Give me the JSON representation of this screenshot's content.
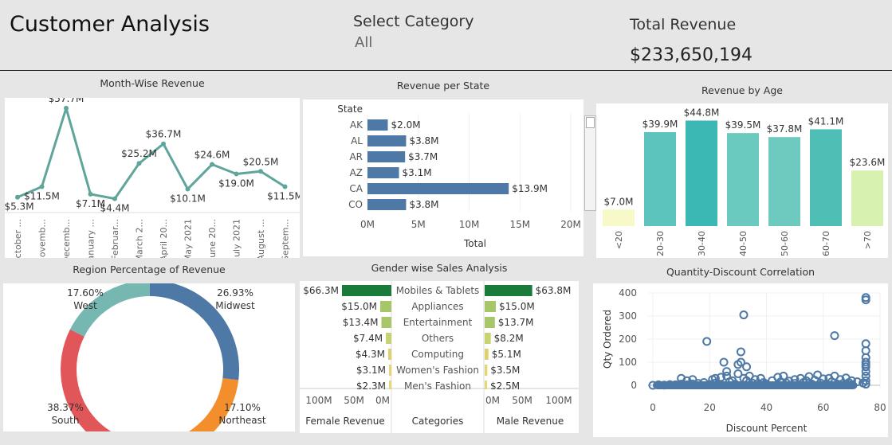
{
  "header": {
    "title": "Customer Analysis",
    "category_label": "Select Category",
    "category_value": "All",
    "revenue_label": "Total Revenue",
    "revenue_value": "$233,650,194"
  },
  "panels": {
    "month": "Month-Wise Revenue",
    "state": "Revenue per State",
    "age": "Revenue by Age",
    "region": "Region Percentage of Revenue",
    "gender": "Gender wise Sales Analysis",
    "qd": "Quantity-Discount Correlation"
  },
  "chart_data": [
    {
      "type": "line",
      "title": "Month-Wise Revenue",
      "color": "#5fa59b",
      "categories": [
        "October ...",
        "Novemb...",
        "Decemb...",
        "January ...",
        "Februar...",
        "March 2...",
        "April 20...",
        "May 2021",
        "June 20...",
        "July 2021",
        "August ...",
        "Septem..."
      ],
      "values": [
        5.3,
        11.5,
        57.7,
        7.1,
        4.4,
        25.2,
        36.7,
        10.1,
        24.6,
        19.0,
        20.5,
        11.5
      ],
      "labels": [
        "$5.3M",
        "$11.5M",
        "$57.7M",
        "$7.1M",
        "$4.4M",
        "$25.2M",
        "$36.7M",
        "$10.1M",
        "$24.6M",
        "$19.0M",
        "$20.5M",
        "$11.5M"
      ],
      "ylim": [
        0,
        60
      ]
    },
    {
      "type": "bar",
      "title": "Revenue per State",
      "orientation": "horizontal",
      "color": "#4e79a7",
      "row_header": "State",
      "categories": [
        "AK",
        "AL",
        "AR",
        "AZ",
        "CA",
        "CO"
      ],
      "values": [
        2.0,
        3.8,
        3.7,
        3.1,
        13.9,
        3.8
      ],
      "labels": [
        "$2.0M",
        "$3.8M",
        "$3.7M",
        "$3.1M",
        "$13.9M",
        "$3.8M"
      ],
      "xticks": [
        "0M",
        "5M",
        "10M",
        "15M",
        "20M"
      ],
      "xlabel": "Total",
      "xlim": [
        0,
        20
      ]
    },
    {
      "type": "bar",
      "title": "Revenue by Age",
      "categories": [
        "<20",
        "20-30",
        "30-40",
        "40-50",
        "50-60",
        "60-70",
        ">70"
      ],
      "values": [
        7.0,
        39.9,
        44.8,
        39.5,
        37.8,
        41.1,
        23.6
      ],
      "labels": [
        "$7.0M",
        "$39.9M",
        "$44.8M",
        "$39.5M",
        "$37.8M",
        "$41.1M",
        "$23.6M"
      ],
      "colors": [
        "#f7f9c8",
        "#5cc4bc",
        "#3cb8b4",
        "#6bcac0",
        "#6ecabf",
        "#4fbfb6",
        "#d7f2b0"
      ],
      "ylim": [
        0,
        48
      ]
    },
    {
      "type": "pie",
      "title": "Region Percentage of Revenue",
      "donut": true,
      "slices": [
        {
          "name": "Midwest",
          "pct": "26.93%",
          "value": 26.93,
          "color": "#4e79a7"
        },
        {
          "name": "Northeast",
          "pct": "17.10%",
          "value": 17.1,
          "color": "#f28e2b"
        },
        {
          "name": "South",
          "pct": "38.37%",
          "value": 38.37,
          "color": "#e15759"
        },
        {
          "name": "West",
          "pct": "17.60%",
          "value": 17.6,
          "color": "#76b7b2"
        }
      ]
    },
    {
      "type": "bar",
      "title": "Gender wise Sales Analysis",
      "orientation": "horizontal",
      "categories": [
        "Mobiles & Tablets",
        "Appliances",
        "Entertainment",
        "Others",
        "Computing",
        "Women's Fashion",
        "Men's Fashion"
      ],
      "female": [
        66.3,
        15.0,
        13.4,
        7.4,
        4.3,
        3.1,
        2.3
      ],
      "female_labels": [
        "$66.3M",
        "$15.0M",
        "$13.4M",
        "$7.4M",
        "$4.3M",
        "$3.1M",
        "$2.3M"
      ],
      "male": [
        63.8,
        15.0,
        13.7,
        8.2,
        5.1,
        3.5,
        2.5
      ],
      "male_labels": [
        "$63.8M",
        "$15.0M",
        "$13.7M",
        "$8.2M",
        "$5.1M",
        "$3.5M",
        "$2.5M"
      ],
      "colors": [
        "#1a7a3a",
        "#a7c667",
        "#a9c66a",
        "#c7d36c",
        "#dcd16c",
        "#e2d572",
        "#e7d877"
      ],
      "female_ticks": [
        "100M",
        "50M",
        "0M"
      ],
      "male_ticks": [
        "0M",
        "50M",
        "100M"
      ],
      "female_label": "Female Revenue",
      "categories_label": "Categories",
      "male_label": "Male Revenue"
    },
    {
      "type": "scatter",
      "title": "Quantity-Discount Correlation",
      "color": "#4e79a7",
      "xlabel": "Discount Percent",
      "ylabel": "Qty Ordered",
      "xticks": [
        "0",
        "20",
        "40",
        "60",
        "80"
      ],
      "yticks": [
        "0",
        "100",
        "200",
        "300",
        "400"
      ],
      "xlim": [
        0,
        80
      ],
      "ylim": [
        0,
        400
      ],
      "grid": true,
      "points": [
        [
          0,
          0
        ],
        [
          2,
          2
        ],
        [
          4,
          1
        ],
        [
          6,
          3
        ],
        [
          8,
          2
        ],
        [
          10,
          5
        ],
        [
          10,
          30
        ],
        [
          12,
          20
        ],
        [
          12,
          2
        ],
        [
          14,
          25
        ],
        [
          14,
          6
        ],
        [
          16,
          8
        ],
        [
          18,
          12
        ],
        [
          19,
          190
        ],
        [
          20,
          4
        ],
        [
          21,
          25
        ],
        [
          22,
          30
        ],
        [
          22,
          10
        ],
        [
          23,
          5
        ],
        [
          24,
          35
        ],
        [
          24,
          2
        ],
        [
          25,
          100
        ],
        [
          26,
          60
        ],
        [
          26,
          40
        ],
        [
          27,
          15
        ],
        [
          28,
          20
        ],
        [
          29,
          5
        ],
        [
          30,
          90
        ],
        [
          30,
          50
        ],
        [
          31,
          145
        ],
        [
          31,
          100
        ],
        [
          32,
          305
        ],
        [
          32,
          30
        ],
        [
          33,
          80
        ],
        [
          33,
          20
        ],
        [
          34,
          40
        ],
        [
          35,
          10
        ],
        [
          36,
          25
        ],
        [
          37,
          8
        ],
        [
          38,
          30
        ],
        [
          39,
          12
        ],
        [
          40,
          5
        ],
        [
          42,
          20
        ],
        [
          44,
          35
        ],
        [
          45,
          15
        ],
        [
          46,
          40
        ],
        [
          47,
          10
        ],
        [
          48,
          18
        ],
        [
          50,
          25
        ],
        [
          50,
          8
        ],
        [
          52,
          30
        ],
        [
          53,
          12
        ],
        [
          54,
          20
        ],
        [
          55,
          38
        ],
        [
          56,
          5
        ],
        [
          57,
          22
        ],
        [
          58,
          45
        ],
        [
          59,
          10
        ],
        [
          60,
          28
        ],
        [
          61,
          6
        ],
        [
          62,
          30
        ],
        [
          63,
          15
        ],
        [
          64,
          40
        ],
        [
          64,
          215
        ],
        [
          65,
          5
        ],
        [
          66,
          25
        ],
        [
          67,
          8
        ],
        [
          68,
          32
        ],
        [
          69,
          12
        ],
        [
          70,
          20
        ],
        [
          70,
          3
        ],
        [
          72,
          15
        ],
        [
          74,
          10
        ],
        [
          75,
          380
        ],
        [
          75,
          370
        ],
        [
          75,
          180
        ],
        [
          75,
          150
        ],
        [
          75,
          120
        ],
        [
          75,
          100
        ],
        [
          75,
          90
        ],
        [
          75,
          80
        ],
        [
          75,
          60
        ],
        [
          75,
          40
        ],
        [
          75,
          20
        ],
        [
          75,
          5
        ]
      ]
    }
  ]
}
